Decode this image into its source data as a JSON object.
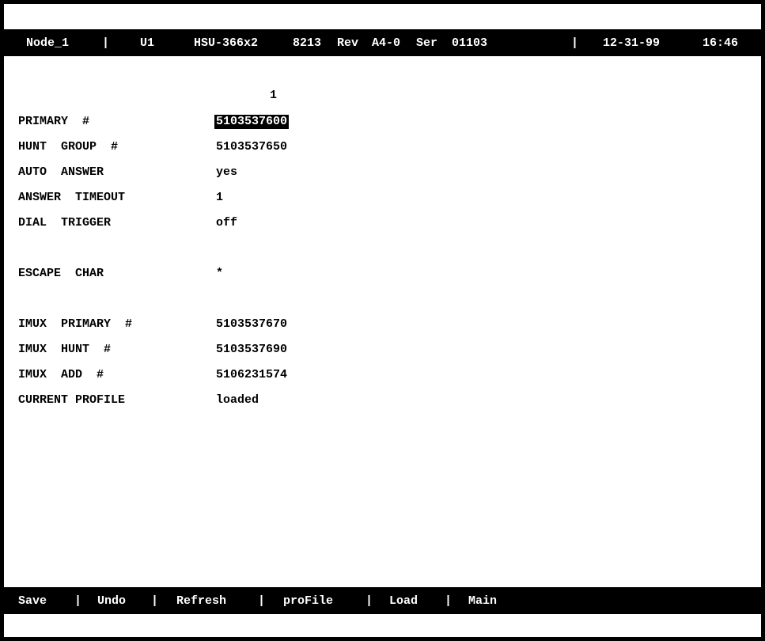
{
  "header": {
    "node": "Node_1",
    "unit": "U1",
    "model": "HSU-366x2",
    "part": "8213",
    "rev_label": "Rev",
    "rev": "A4-0",
    "ser_label": "Ser",
    "serial": "01103",
    "date": "12-31-99",
    "time": "16:46",
    "sep": "|"
  },
  "column_header": "1",
  "fields": {
    "primary": {
      "label": "PRIMARY  #",
      "value": "5103537600"
    },
    "hunt_group": {
      "label": "HUNT  GROUP  #",
      "value": "5103537650"
    },
    "auto_answer": {
      "label": "AUTO  ANSWER",
      "value": "yes"
    },
    "answer_timeout": {
      "label": "ANSWER  TIMEOUT",
      "value": "1"
    },
    "dial_trigger": {
      "label": "DIAL  TRIGGER",
      "value": "off"
    },
    "escape_char": {
      "label": "ESCAPE  CHAR",
      "value": "*"
    },
    "imux_primary": {
      "label": "IMUX  PRIMARY  #",
      "value": "5103537670"
    },
    "imux_hunt": {
      "label": "IMUX  HUNT  #",
      "value": "5103537690"
    },
    "imux_add": {
      "label": "IMUX  ADD  #",
      "value": "5106231574"
    },
    "current_profile": {
      "label": "CURRENT PROFILE",
      "value": "loaded"
    }
  },
  "footer": {
    "save": "Save",
    "undo": "Undo",
    "refresh": "Refresh",
    "profile": "proFile",
    "load": "Load",
    "main": "Main",
    "sep": "|"
  },
  "colors": {
    "background": "#ffffff",
    "bar": "#000000",
    "text": "#000000",
    "bar_text": "#ffffff"
  }
}
